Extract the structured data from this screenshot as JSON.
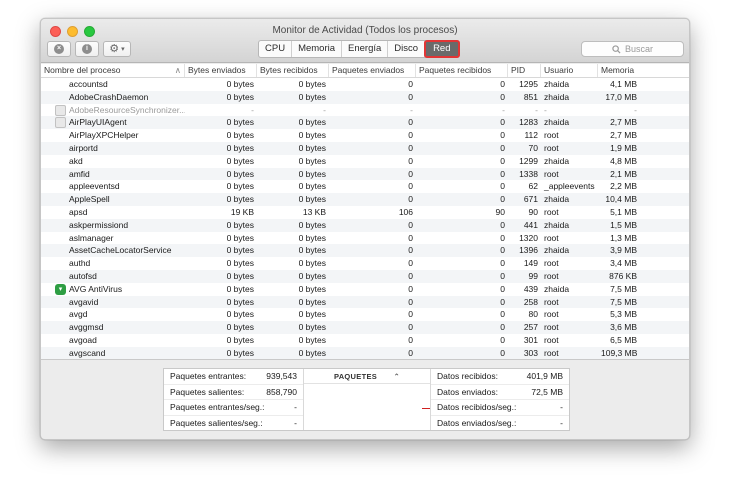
{
  "window": {
    "title": "Monitor de Actividad (Todos los procesos)"
  },
  "toolbar": {
    "tabs": [
      "CPU",
      "Memoria",
      "Energía",
      "Disco",
      "Red"
    ],
    "active_tab": "Red",
    "search_placeholder": "Buscar"
  },
  "table": {
    "columns": [
      "Nombre del proceso",
      "Bytes enviados",
      "Bytes recibidos",
      "Paquetes enviados",
      "Paquetes recibidos",
      "PID",
      "Usuario",
      "Memoria"
    ],
    "rows": [
      [
        "accountsd",
        "0 bytes",
        "0 bytes",
        "0",
        "0",
        "1295",
        "zhaida",
        "4,1 MB"
      ],
      [
        "AdobeCrashDaemon",
        "0 bytes",
        "0 bytes",
        "0",
        "0",
        "851",
        "zhaida",
        "17,0 MB"
      ],
      [
        "AdobeResourceSynchronizer...",
        "-",
        "-",
        "-",
        "-",
        "-",
        "-",
        "-"
      ],
      [
        "AirPlayUIAgent",
        "0 bytes",
        "0 bytes",
        "0",
        "0",
        "1283",
        "zhaida",
        "2,7 MB"
      ],
      [
        "AirPlayXPCHelper",
        "0 bytes",
        "0 bytes",
        "0",
        "0",
        "112",
        "root",
        "2,7 MB"
      ],
      [
        "airportd",
        "0 bytes",
        "0 bytes",
        "0",
        "0",
        "70",
        "root",
        "1,9 MB"
      ],
      [
        "akd",
        "0 bytes",
        "0 bytes",
        "0",
        "0",
        "1299",
        "zhaida",
        "4,8 MB"
      ],
      [
        "amfid",
        "0 bytes",
        "0 bytes",
        "0",
        "0",
        "1338",
        "root",
        "2,1 MB"
      ],
      [
        "appleeventsd",
        "0 bytes",
        "0 bytes",
        "0",
        "0",
        "62",
        "_appleevents",
        "2,2 MB"
      ],
      [
        "AppleSpell",
        "0 bytes",
        "0 bytes",
        "0",
        "0",
        "671",
        "zhaida",
        "10,4 MB"
      ],
      [
        "apsd",
        "19 KB",
        "13 KB",
        "106",
        "90",
        "90",
        "root",
        "5,1 MB"
      ],
      [
        "askpermissiond",
        "0 bytes",
        "0 bytes",
        "0",
        "0",
        "441",
        "zhaida",
        "1,5 MB"
      ],
      [
        "aslmanager",
        "0 bytes",
        "0 bytes",
        "0",
        "0",
        "1320",
        "root",
        "1,3 MB"
      ],
      [
        "AssetCacheLocatorService",
        "0 bytes",
        "0 bytes",
        "0",
        "0",
        "1396",
        "zhaida",
        "3,9 MB"
      ],
      [
        "authd",
        "0 bytes",
        "0 bytes",
        "0",
        "0",
        "149",
        "root",
        "3,4 MB"
      ],
      [
        "autofsd",
        "0 bytes",
        "0 bytes",
        "0",
        "0",
        "99",
        "root",
        "876 KB"
      ],
      [
        "AVG AntiVirus",
        "0 bytes",
        "0 bytes",
        "0",
        "0",
        "439",
        "zhaida",
        "7,5 MB"
      ],
      [
        "avgavid",
        "0 bytes",
        "0 bytes",
        "0",
        "0",
        "258",
        "root",
        "7,5 MB"
      ],
      [
        "avgd",
        "0 bytes",
        "0 bytes",
        "0",
        "0",
        "80",
        "root",
        "5,3 MB"
      ],
      [
        "avggmsd",
        "0 bytes",
        "0 bytes",
        "0",
        "0",
        "257",
        "root",
        "3,6 MB"
      ],
      [
        "avgoad",
        "0 bytes",
        "0 bytes",
        "0",
        "0",
        "301",
        "root",
        "6,5 MB"
      ],
      [
        "avgscand",
        "0 bytes",
        "0 bytes",
        "0",
        "0",
        "303",
        "root",
        "109,3 MB"
      ]
    ],
    "icon_rows": {
      "2": "generic-app-icon",
      "3": "generic-app-icon",
      "16": "avg-shield-icon"
    }
  },
  "stats": {
    "left": [
      {
        "label": "Paquetes entrantes:",
        "value": "939,543"
      },
      {
        "label": "Paquetes salientes:",
        "value": "858,790"
      },
      {
        "label": "Paquetes entrantes/seg.:",
        "value": "-"
      },
      {
        "label": "Paquetes salientes/seg.:",
        "value": "-"
      }
    ],
    "selector_label": "PAQUETES",
    "right": [
      {
        "label": "Datos recibidos:",
        "value": "401,9 MB"
      },
      {
        "label": "Datos enviados:",
        "value": "72,5 MB"
      },
      {
        "label": "Datos recibidos/seg.:",
        "value": "-"
      },
      {
        "label": "Datos enviados/seg.:",
        "value": "-"
      }
    ],
    "accent_color": "#d02020"
  }
}
